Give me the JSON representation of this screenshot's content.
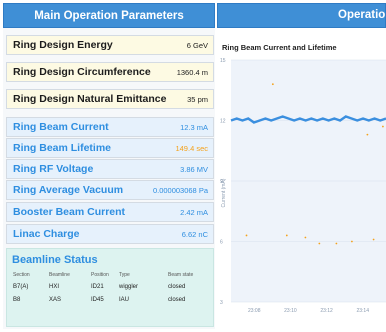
{
  "params": {
    "header": "Main Operation Parameters",
    "rows": [
      {
        "label": "Ring Design Energy",
        "value": "6 GeV"
      },
      {
        "label": "Ring Design Circumference",
        "value": "1360.4 m"
      },
      {
        "label": "Ring Design Natural Emittance",
        "value": "35 pm"
      },
      {
        "label": "Ring Beam Current",
        "value": "12.3 mA"
      },
      {
        "label": "Ring Beam Lifetime",
        "value": "149.4 sec"
      },
      {
        "label": "Ring RF Voltage",
        "value": "3.86 MV"
      },
      {
        "label": "Ring Average Vacuum",
        "value": "0.000003068 Pa"
      },
      {
        "label": "Booster Beam Current",
        "value": "2.42 mA"
      },
      {
        "label": "Linac Charge",
        "value": "6.62 nC"
      }
    ]
  },
  "beamline": {
    "title": "Beamline Status",
    "columns": [
      "Section",
      "Beamline",
      "Position",
      "Type",
      "Beam state"
    ],
    "rows": [
      [
        "B7(A)",
        "HXI",
        "ID21",
        "wiggler",
        "closed"
      ],
      [
        "B8",
        "XAS",
        "ID45",
        "IAU",
        "closed"
      ]
    ]
  },
  "operation": {
    "header": "Operation",
    "chart_title": "Ring Beam Current and Lifetime"
  },
  "colors": {
    "header_blue": "#3f8fd6",
    "value_blue": "#2e8ee0",
    "current_series": "#3b8fdf",
    "lifetime_series": "#f4a21c"
  },
  "chart_data": {
    "type": "line",
    "title": "Ring Beam Current and Lifetime",
    "ylabel": "Current (mA)",
    "yticks": [
      "15",
      "12",
      "9",
      "6",
      "3"
    ],
    "ylim": [
      3,
      15
    ],
    "xticks": [
      "23:08",
      "23:10",
      "23:12",
      "23:14"
    ],
    "grid": true,
    "series": [
      {
        "values": [
          12.0,
          12.1,
          12.0,
          12.1,
          11.9,
          12.0,
          12.1,
          12.0,
          12.1,
          12.2,
          12.1,
          12.0,
          12.1,
          12.0,
          12.1,
          12.0,
          12.1,
          12.0,
          12.1,
          12.0,
          12.2,
          12.1,
          12.0,
          12.1,
          12.0,
          12.1,
          12.0,
          12.1
        ]
      },
      {
        "points": [
          [
            0.1,
            6.3
          ],
          [
            0.27,
            13.8
          ],
          [
            0.36,
            6.3
          ],
          [
            0.48,
            6.2
          ],
          [
            0.57,
            5.9
          ],
          [
            0.68,
            5.9
          ],
          [
            0.78,
            6.0
          ],
          [
            0.88,
            11.3
          ],
          [
            0.92,
            6.1
          ],
          [
            0.98,
            11.7
          ]
        ]
      }
    ]
  }
}
